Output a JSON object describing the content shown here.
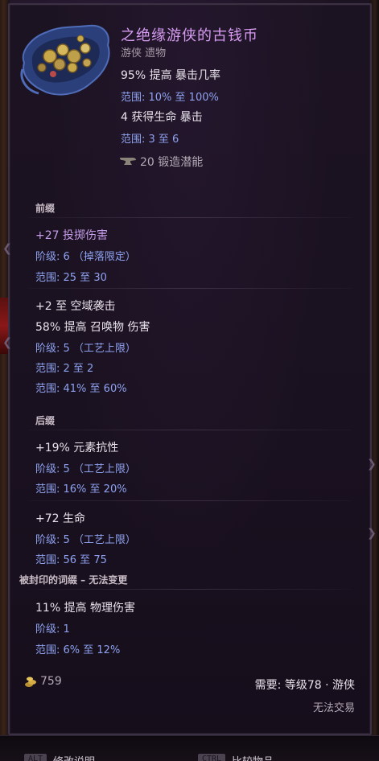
{
  "item": {
    "name": "之绝缘游侠的古钱币",
    "type": "游侠 遗物",
    "implicits": [
      {
        "text": "95% 提高 暴击几率",
        "range": "范围: 10% 至 100%"
      },
      {
        "text": "4 获得生命 暴击",
        "range": "范围: 3 至 6"
      }
    ],
    "forging_potential": "20 锻造潜能"
  },
  "prefix": {
    "header": "前缀",
    "affixes": [
      {
        "lines": [
          "+27 投掷伤害"
        ],
        "tier": "阶级: 6 （掉落限定）",
        "range": "范围: 25 至 30"
      },
      {
        "lines": [
          "+2 至 空域袭击",
          "58% 提高 召唤物 伤害"
        ],
        "tier": "阶级: 5 （工艺上限）",
        "range": "范围: 2 至 2",
        "range2": "范围: 41% 至 60%"
      }
    ]
  },
  "suffix": {
    "header": "后缀",
    "affixes": [
      {
        "lines": [
          "+19% 元素抗性"
        ],
        "tier": "阶级: 5 （工艺上限）",
        "range": "范围: 16% 至 20%"
      },
      {
        "lines": [
          "+72 生命"
        ],
        "tier": "阶级: 5 （工艺上限）",
        "range": "范围: 56 至 75"
      }
    ]
  },
  "sealed": {
    "header": "被封印的词缀 – 无法变更",
    "lines": [
      "11% 提高 物理伤害"
    ],
    "tier": "阶级: 1",
    "range": "范围: 6% 至 12%"
  },
  "bottom": {
    "gold": "759",
    "requirement": "需要: 等级78 · 游侠",
    "untradeable": "无法交易"
  },
  "footer": {
    "alt_key": "ALT",
    "alt_label": "修改说明",
    "ctrl_key": "CTRL",
    "ctrl_label": "比较物品"
  },
  "colors": {
    "item_name": "#d79cf2",
    "range_text": "#8ea2f0",
    "mod_text": "#e8e2ea"
  }
}
